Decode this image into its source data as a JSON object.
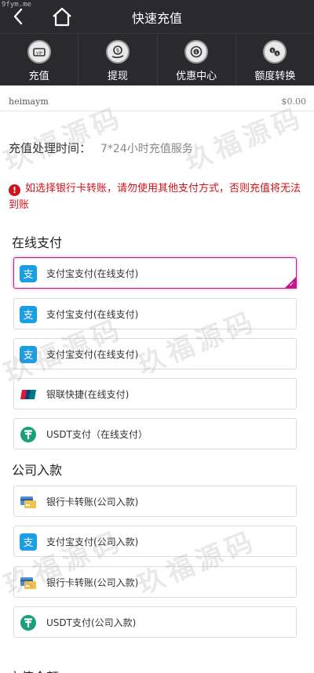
{
  "site_tag": "9fym.me",
  "header": {
    "title": "快速充值"
  },
  "nav": [
    {
      "label": "充值",
      "icon": "deposit-icon"
    },
    {
      "label": "提现",
      "icon": "withdraw-icon"
    },
    {
      "label": "优惠中心",
      "icon": "promo-icon"
    },
    {
      "label": "额度转换",
      "icon": "transfer-icon"
    }
  ],
  "account": {
    "name": "heimaym",
    "balance": "$0.00"
  },
  "processing": {
    "label": "充值处理时间：",
    "value": "7*24小时充值服务"
  },
  "warning": {
    "text": "如选择银行卡转账，请勿使用其他支付方式，否则充值将无法到账"
  },
  "online": {
    "title": "在线支付",
    "items": [
      {
        "label": "支付宝支付(在线支付)",
        "icon": "alipay-icon",
        "selected": true
      },
      {
        "label": "支付宝支付(在线支付)",
        "icon": "alipay-icon"
      },
      {
        "label": "支付宝支付(在线支付)",
        "icon": "alipay-icon"
      },
      {
        "label": "银联快捷(在线支付)",
        "icon": "unionpay-icon"
      },
      {
        "label": "USDT支付（在线支付）",
        "icon": "usdt-icon"
      }
    ]
  },
  "company": {
    "title": "公司入款",
    "items": [
      {
        "label": "银行卡转账(公司入款)",
        "icon": "bank-card-icon"
      },
      {
        "label": "支付宝支付(公司入款)",
        "icon": "alipay-icon"
      },
      {
        "label": "银行卡转账(公司入款)",
        "icon": "bank-card-icon"
      },
      {
        "label": "USDT支付(公司入款)",
        "icon": "usdt-icon"
      }
    ]
  },
  "bottom_section": {
    "title": "充值金额"
  },
  "watermark": "玖福源码",
  "colors": {
    "header_bg": "#2a2a2e",
    "warning": "#d0121b",
    "selected": "#c0198a",
    "alipay": "#1a9ee6",
    "usdt": "#1aa17a"
  }
}
